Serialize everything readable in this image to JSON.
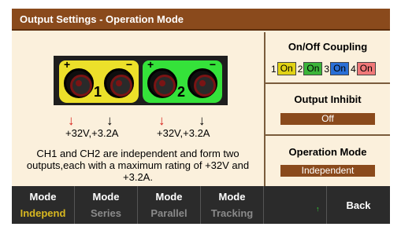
{
  "title": "Output Settings - Operation Mode",
  "terminals": {
    "ch1": {
      "number": "1",
      "plus": "+",
      "minus": "−",
      "rating": "+32V,+3.2A",
      "color": "#ece02a"
    },
    "ch2": {
      "number": "2",
      "plus": "+",
      "minus": "−",
      "rating": "+32V,+3.2A",
      "color": "#35e23a"
    },
    "arrows": {
      "red": "↓",
      "black": "↓"
    }
  },
  "description": "CH1 and CH2 are independent and form two outputs,each with a maximum rating of +32V and +3.2A.",
  "side": {
    "coupling": {
      "title": "On/Off Coupling",
      "items": [
        {
          "num": "1",
          "state": "On",
          "color": "#e1d215"
        },
        {
          "num": "2",
          "state": "On",
          "color": "#3cb43a"
        },
        {
          "num": "3",
          "state": "On",
          "color": "#2a6fd6"
        },
        {
          "num": "4",
          "state": "On",
          "color": "#f07878"
        }
      ]
    },
    "inhibit": {
      "title": "Output Inhibit",
      "value": "Off"
    },
    "mode": {
      "title": "Operation Mode",
      "value": "Independent"
    }
  },
  "softkeys": [
    {
      "top": "Mode",
      "bottom": "Independ",
      "active": true
    },
    {
      "top": "Mode",
      "bottom": "Series",
      "active": false
    },
    {
      "top": "Mode",
      "bottom": "Parallel",
      "active": false
    },
    {
      "top": "Mode",
      "bottom": "Tracking",
      "active": false
    },
    {
      "top": "",
      "bottom": "",
      "active": false
    },
    {
      "label": "Back"
    }
  ],
  "colors": {
    "title_bar": "#8a4a1c",
    "panel_bg": "#fbf0dc",
    "active_softkey": "#d8b820"
  }
}
